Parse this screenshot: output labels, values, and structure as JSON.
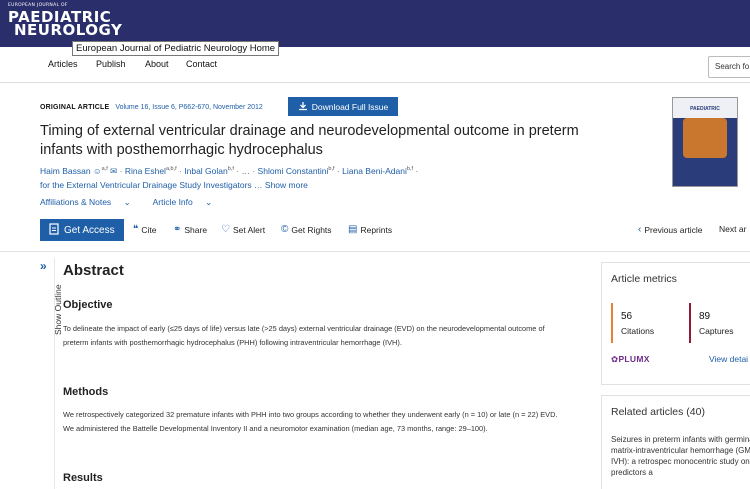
{
  "header": {
    "logo": {
      "small": "EUROPEAN JOURNAL OF",
      "line1": "PAEDIATRIC",
      "line2": "NEUROLOGY"
    },
    "tooltip": "European Journal of Pediatric Neurology Home",
    "nav": [
      "Articles",
      "Publish",
      "About",
      "Contact"
    ],
    "search_placeholder": "Search fo"
  },
  "article": {
    "type": "ORIGINAL ARTICLE",
    "volume": "Volume 16, Issue 6, P662-670, November 2012",
    "download": "Download Full Issue",
    "title": "Timing of external ventricular drainage and neurodevelopmental outcome in preterm infants with posthemorrhagic hydrocephalus",
    "authors": [
      {
        "name": "Haim Bassan",
        "sup": "a,f"
      },
      {
        "name": "Rina Eshel",
        "sup": "a,b,f"
      },
      {
        "name": "Inbal Golan",
        "sup": "b,f"
      },
      {
        "name": "…",
        "sup": ""
      },
      {
        "name": "Shlomi Constantini",
        "sup": "b,f"
      },
      {
        "name": "Liana Beni-Adani",
        "sup": "b,f"
      }
    ],
    "authors_line2": "for the External Ventricular Drainage Study Investigators",
    "show_more": "… Show more",
    "affiliations": "Affiliations & Notes",
    "article_info": "Article Info"
  },
  "actions": {
    "get_access": "Get Access",
    "cite": "Cite",
    "share": "Share",
    "set_alert": "Set Alert",
    "get_rights": "Get Rights",
    "reprints": "Reprints",
    "previous": "Previous article",
    "next": "Next ar"
  },
  "outline": {
    "label": "Show Outline"
  },
  "abstract": {
    "heading": "Abstract",
    "objective_h": "Objective",
    "objective": "To delineate the impact of early (≤25 days of life) versus late (>25 days) external ventricular drainage (EVD) on the neurodevelopmental outcome of preterm infants with posthemorrhagic hydrocephalus (PHH) following intraventricular hemorrhage (IVH).",
    "methods_h": "Methods",
    "methods": "We retrospectively categorized 32 premature infants with PHH into two groups according to whether they underwent early (n = 10) or late (n = 22) EVD. We administered the Battelle Developmental Inventory II and a neuromotor examination (median age, 73 months, range: 29–100).",
    "results_h": "Results"
  },
  "sidebar": {
    "metrics_h": "Article metrics",
    "citations_num": "56",
    "citations_lbl": "Citations",
    "captures_num": "89",
    "captures_lbl": "Captures",
    "plumx": "PLUMX",
    "view_details": "View detai",
    "related_h": "Related articles (40)",
    "related_1": "Seizures in preterm infants with germinal-matrix-intraventricular hemorrhage (GM-IVH): a retrospec monocentric study on predictors a"
  },
  "colors": {
    "header_bg": "#2a2f6b",
    "accent": "#1f5fa8",
    "citations_bar": "#e8822e",
    "captures_bar": "#8e1b3a",
    "plumx": "#6e2b8a"
  }
}
